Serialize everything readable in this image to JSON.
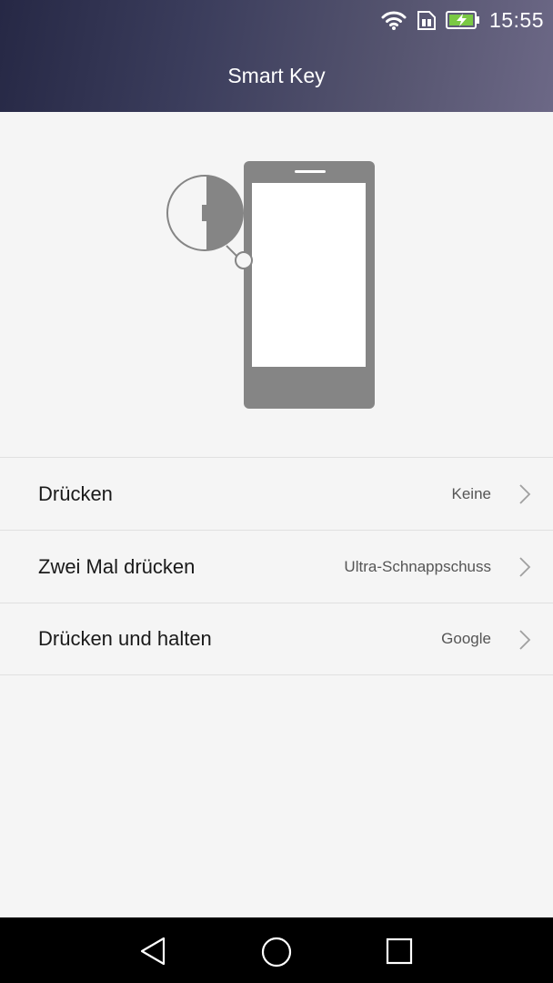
{
  "status_bar": {
    "time": "15:55",
    "icons": [
      "wifi-icon",
      "sim-icon",
      "battery-charging-icon"
    ]
  },
  "header": {
    "title": "Smart Key"
  },
  "illustration": {
    "description_icon": "phone-smart-key-icon"
  },
  "settings": {
    "items": [
      {
        "label": "Drücken",
        "value": "Keine"
      },
      {
        "label": "Zwei Mal drücken",
        "value": "Ultra-Schnappschuss"
      },
      {
        "label": "Drücken und halten",
        "value": "Google"
      }
    ]
  },
  "navbar": {
    "buttons": [
      "back-icon",
      "home-icon",
      "recents-icon"
    ]
  },
  "colors": {
    "header_start": "#262845",
    "header_end": "#6c6886",
    "phone_gray": "#858585",
    "battery_green": "#7ac943"
  }
}
